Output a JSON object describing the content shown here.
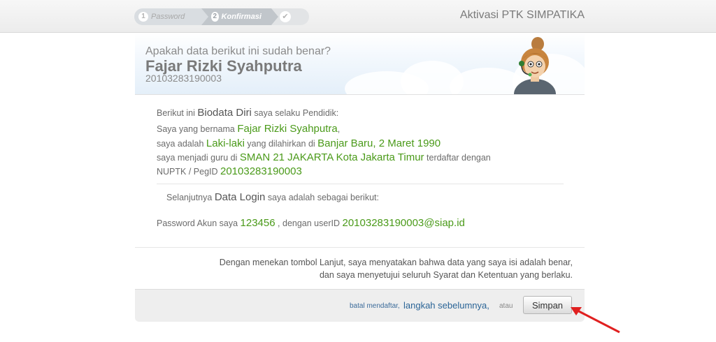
{
  "steps": [
    {
      "num": "1",
      "label": "Password"
    },
    {
      "num": "2",
      "label": "Konfirmasi"
    },
    {
      "num": "",
      "label": ""
    }
  ],
  "app_title": "Aktivasi PTK SIMPATIKA",
  "header": {
    "question": "Apakah data berikut ini sudah benar?",
    "name": "Fajar Rizki Syahputra",
    "id": "20103283190003"
  },
  "bio": {
    "intro_prefix": "Berikut ini ",
    "intro_big": "Biodata Diri",
    "intro_suffix": " saya selaku Pendidik:",
    "l1_prefix": "Saya yang bernama ",
    "l1_name": "Fajar Rizki Syahputra",
    "l1_suffix": ",",
    "l2_prefix": "saya adalah ",
    "l2_gender": "Laki-laki",
    "l2_mid": " yang dilahirkan di ",
    "l2_birth": "Banjar Baru, 2 Maret 1990",
    "l3_prefix": "saya menjadi guru di ",
    "l3_school": "SMAN 21 JAKARTA Kota Jakarta Timur",
    "l3_suffix": " terdaftar dengan",
    "l4_prefix": "NUPTK / PegID ",
    "l4_id": "20103283190003"
  },
  "login": {
    "intro_prefix": "Selanjutnya ",
    "intro_big": "Data Login",
    "intro_suffix": " saya adalah sebagai berikut:",
    "pw_prefix": "Password Akun saya ",
    "pw_value": "123456",
    "pw_mid": " , dengan userID ",
    "user_id": "20103283190003@siap.id"
  },
  "agreement": {
    "line1": "Dengan menekan tombol Lanjut, saya menyatakan bahwa data yang saya isi adalah benar,",
    "line2": "dan saya menyetujui seluruh Syarat dan Ketentuan yang berlaku."
  },
  "footer": {
    "cancel": "batal mendaftar,",
    "prev": "langkah sebelumnya",
    "prev_suffix": ",",
    "atau": "atau",
    "save": "Simpan"
  },
  "icons": {
    "step_done": "check-icon",
    "annotation": "red-arrow-icon"
  }
}
